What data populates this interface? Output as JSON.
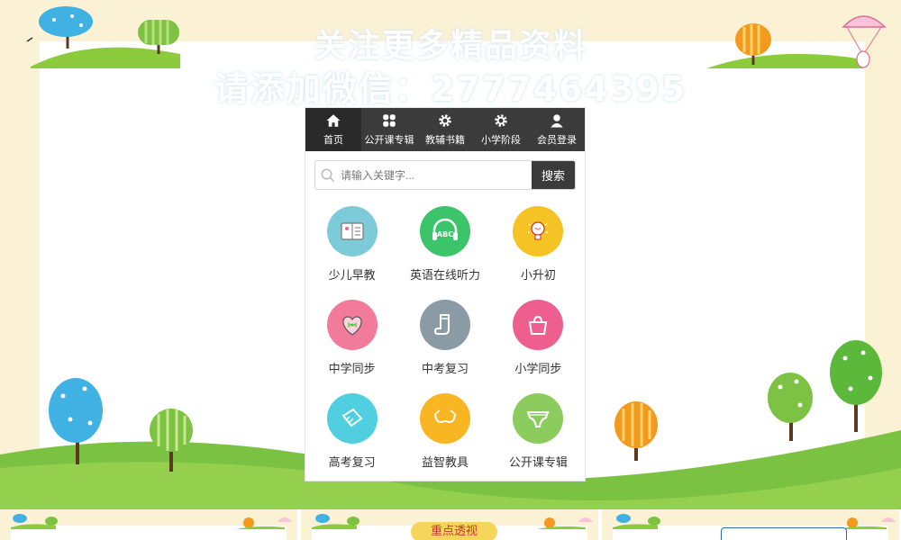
{
  "watermark": {
    "line1": "关注更多精品资料",
    "line2": "请添加微信：2777464395"
  },
  "nav": [
    {
      "label": "首页",
      "icon": "home-icon",
      "active": true
    },
    {
      "label": "公开课专辑",
      "icon": "grid-icon",
      "active": false
    },
    {
      "label": "教辅书籍",
      "icon": "gear-icon",
      "active": false
    },
    {
      "label": "小学阶段",
      "icon": "gear-icon",
      "active": false
    },
    {
      "label": "会员登录",
      "icon": "user-icon",
      "active": false
    }
  ],
  "search": {
    "placeholder": "请输入关键字...",
    "button_label": "搜索"
  },
  "tiles": [
    {
      "label": "少儿早教",
      "icon": "card-icon",
      "color": "#7dcbd9"
    },
    {
      "label": "英语在线听力",
      "icon": "headphones-abc-icon",
      "color": "#3cc46a"
    },
    {
      "label": "小升初",
      "icon": "lightbulb-icon",
      "color": "#f6c324"
    },
    {
      "label": "中学同步",
      "icon": "heart-bow-icon",
      "color": "#f27a9a"
    },
    {
      "label": "中考复习",
      "icon": "sock-icon",
      "color": "#8a9ba6"
    },
    {
      "label": "小学同步",
      "icon": "bag-icon",
      "color": "#ee5e8f"
    },
    {
      "label": "高考复习",
      "icon": "paper-icon",
      "color": "#4fcfe0"
    },
    {
      "label": "益智教具",
      "icon": "bra-icon",
      "color": "#f8b622"
    },
    {
      "label": "公开课专辑",
      "icon": "underwear-icon",
      "color": "#8ccb5e"
    }
  ],
  "strip": {
    "pill_label": "重点透视"
  },
  "colors": {
    "nav_bg": "#3b3b3b",
    "grass": "#7cc242",
    "page_bg": "#fbf1d4"
  }
}
